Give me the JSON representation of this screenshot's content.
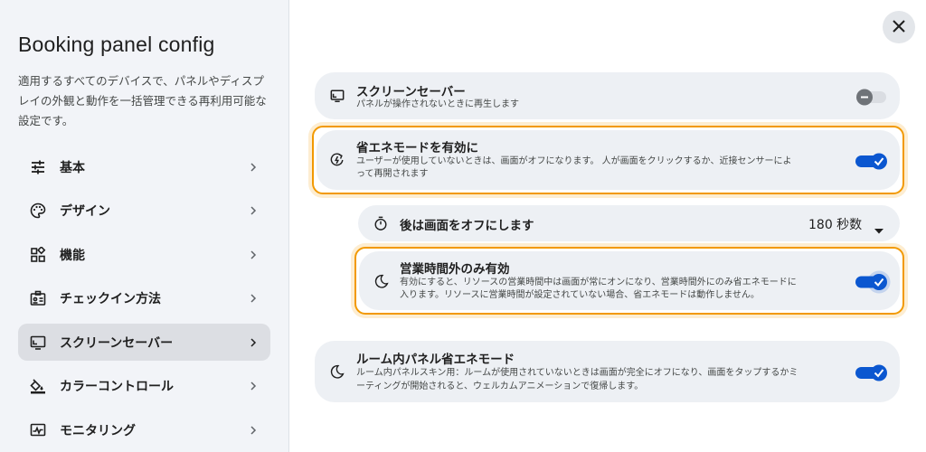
{
  "sidebar": {
    "title": "Booking panel config",
    "description": "適用するすべてのデバイスで、パネルやディスプレイの外観と動作を一括管理できる再利用可能な設定です。",
    "items": [
      {
        "label": "基本",
        "icon": "tune-icon"
      },
      {
        "label": "デザイン",
        "icon": "palette-icon"
      },
      {
        "label": "機能",
        "icon": "widgets-icon"
      },
      {
        "label": "チェックイン方法",
        "icon": "badge-icon"
      },
      {
        "label": "スクリーンセーバー",
        "icon": "screen-icon"
      },
      {
        "label": "カラーコントロール",
        "icon": "paint-bucket-icon"
      },
      {
        "label": "モニタリング",
        "icon": "monitoring-icon"
      }
    ],
    "active_index": 4
  },
  "settings": {
    "screensaver": {
      "title": "スクリーンセーバー",
      "desc": "パネルが操作されないときに再生します",
      "enabled": false
    },
    "eco_mode": {
      "title": "省エネモードを有効に",
      "desc_line1": "ユーザーが使用していないときは、画面がオフになります。 人が画面をクリックするか、近接センサーによ",
      "desc_line2": "って再開されます",
      "enabled": true
    },
    "screen_off": {
      "title": "後は画面をオフにします",
      "value": "180 秒数"
    },
    "business_hours": {
      "title": "営業時間外のみ有効",
      "desc_line1": "有効にすると、リソースの営業時間中は画面が常にオンになり、営業時間外にのみ省エネモードに",
      "desc_line2": "入ります。リソースに営業時間が設定されていない場合、省エネモードは動作しません。",
      "enabled": true
    },
    "room_panel": {
      "title": "ルーム内パネル省エネモード",
      "desc_line1": "ルーム内パネルスキン用：ルームが使用されていないときは画面が完全にオフになり、画面をタップするかミ",
      "desc_line2": "ーティングが開始されると、ウェルカムアニメーションで復帰します。",
      "enabled": true
    }
  },
  "colors": {
    "accent": "#0b57d0",
    "highlight": "#f29900",
    "card": "#edf0f4"
  }
}
